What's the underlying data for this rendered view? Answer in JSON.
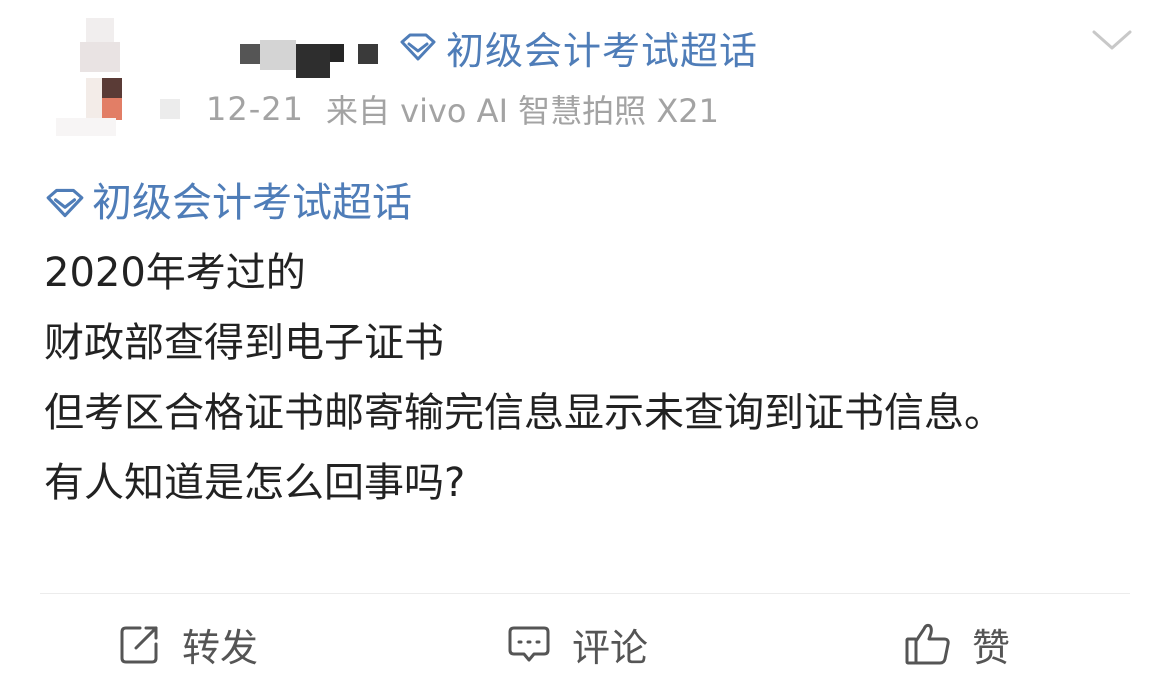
{
  "post": {
    "topic_header": "初级会计考试超话",
    "meta": {
      "time": "12-21",
      "source": "来自 vivo AI 智慧拍照 X21"
    },
    "content": {
      "topic_tag": "初级会计考试超话",
      "lines": [
        "2020年考过的",
        "财政部查得到电子证书",
        "但考区合格证书邮寄输完信息显示未查询到证书信息。",
        "有人知道是怎么回事吗?"
      ]
    },
    "actions": {
      "repost": "转发",
      "comment": "评论",
      "like": "赞"
    }
  },
  "icons": {
    "topic": "diamond-icon",
    "more": "chevron-down-icon",
    "repost": "repost-icon",
    "comment": "comment-icon",
    "like": "thumbs-up-icon"
  },
  "colors": {
    "link": "#4f7db8",
    "text": "#222222",
    "meta": "#a3a3a3",
    "action": "#555555"
  }
}
